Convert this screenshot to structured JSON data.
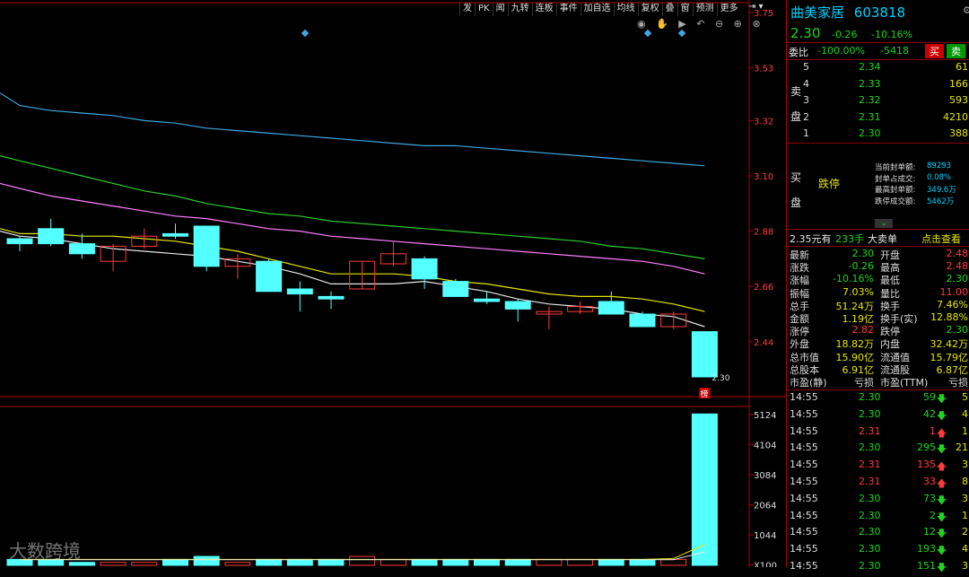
{
  "toolbar": [
    "发",
    "PK",
    "闻",
    "九转",
    "连板",
    "事件",
    "加自选",
    "均线",
    "复权",
    "叠",
    "窗",
    "预测",
    "更多"
  ],
  "stock": {
    "name": "曲美家居",
    "code": "603818",
    "price": "2.30",
    "change": "-0.26",
    "pct": "-10.16%"
  },
  "order_book": {
    "ratio_label": "委比",
    "ratio": "-100.00%",
    "diff": "-5418",
    "buy_btn": "买",
    "sell_btn": "卖",
    "sell_label": "卖盘",
    "buy_label": "买盘",
    "asks": [
      {
        "level": "5",
        "price": "2.34",
        "vol": "61"
      },
      {
        "level": "4",
        "price": "2.33",
        "vol": "166"
      },
      {
        "level": "3",
        "price": "2.32",
        "vol": "593"
      },
      {
        "level": "2",
        "price": "2.31",
        "vol": "4210"
      },
      {
        "level": "1",
        "price": "2.30",
        "vol": "388"
      }
    ],
    "limit_status": "跌停",
    "limit_info": [
      {
        "label": "当前封单额:",
        "value": "89293"
      },
      {
        "label": "封单占成交:",
        "value": "0.08%"
      },
      {
        "label": "最高封单额:",
        "value": "349.6万"
      },
      {
        "label": "跌停成交额:",
        "value": "5462万"
      }
    ]
  },
  "big_order": {
    "text1": "2.35元有",
    "text2": "233手",
    "text3": "大卖单",
    "link": "点击查看"
  },
  "stats": [
    [
      "最新",
      "2.30",
      "开盘",
      "2.48"
    ],
    [
      "涨跌",
      "-0.26",
      "最高",
      "2.48"
    ],
    [
      "涨幅",
      "-10.16%",
      "最低",
      "2.30"
    ],
    [
      "振幅",
      "7.03%",
      "量比",
      "11.00"
    ],
    [
      "总手",
      "51.24万",
      "换手",
      "7.46%"
    ],
    [
      "金额",
      "1.19亿",
      "换手(实)",
      "12.88%"
    ],
    [
      "涨停",
      "2.82",
      "跌停",
      "2.30"
    ],
    [
      "外盘",
      "18.82万",
      "内盘",
      "32.42万"
    ],
    [
      "总市值",
      "15.90亿",
      "流通值",
      "15.79亿"
    ],
    [
      "总股本",
      "6.91亿",
      "流通股",
      "6.87亿"
    ],
    [
      "市盈(静)",
      "亏损",
      "市盈(TTM)",
      "亏损"
    ]
  ],
  "ticks": [
    {
      "time": "14:55",
      "price": "2.30",
      "vol": "59",
      "dir": "down",
      "n": "5"
    },
    {
      "time": "14:55",
      "price": "2.30",
      "vol": "42",
      "dir": "down",
      "n": "4"
    },
    {
      "time": "14:55",
      "price": "2.31",
      "vol": "1",
      "dir": "up",
      "n": "1"
    },
    {
      "time": "14:55",
      "price": "2.30",
      "vol": "295",
      "dir": "down",
      "n": "21"
    },
    {
      "time": "14:55",
      "price": "2.31",
      "vol": "135",
      "dir": "up",
      "n": "3"
    },
    {
      "time": "14:55",
      "price": "2.31",
      "vol": "33",
      "dir": "up",
      "n": "8"
    },
    {
      "time": "14:55",
      "price": "2.30",
      "vol": "73",
      "dir": "down",
      "n": "3"
    },
    {
      "time": "14:55",
      "price": "2.30",
      "vol": "2",
      "dir": "down",
      "n": "1"
    },
    {
      "time": "14:55",
      "price": "2.30",
      "vol": "12",
      "dir": "down",
      "n": "2"
    },
    {
      "time": "14:55",
      "price": "2.30",
      "vol": "193",
      "dir": "down",
      "n": "4"
    },
    {
      "time": "14:55",
      "price": "2.30",
      "vol": "151",
      "dir": "down",
      "n": "3"
    }
  ],
  "price_axis": [
    "3.75",
    "3.53",
    "3.32",
    "3.10",
    "2.88",
    "2.66",
    "2.44"
  ],
  "vol_axis": [
    "5124",
    "4104",
    "3084",
    "2064",
    "1044",
    "X100"
  ],
  "last_price_label": "2.30",
  "badge": "榜",
  "watermark": "大数跨境",
  "colors": {
    "up": "#ff3b3b",
    "down": "#1fd31f",
    "candle_down": "#54ffff",
    "ma1": "#e8e8e8",
    "ma2": "#e6e600",
    "ma3": "#ff80ff",
    "ma4": "#2ecc2e",
    "ma5": "#3fa7e0"
  },
  "chart_data": {
    "type": "candlestick",
    "ylim": [
      2.3,
      3.8
    ],
    "candles": [
      {
        "o": 2.85,
        "c": 2.83,
        "h": 2.86,
        "l": 2.8
      },
      {
        "o": 2.89,
        "c": 2.83,
        "h": 2.93,
        "l": 2.82
      },
      {
        "o": 2.83,
        "c": 2.79,
        "h": 2.87,
        "l": 2.77
      },
      {
        "o": 2.76,
        "c": 2.82,
        "h": 2.83,
        "l": 2.72
      },
      {
        "o": 2.82,
        "c": 2.86,
        "h": 2.89,
        "l": 2.81
      },
      {
        "o": 2.87,
        "c": 2.86,
        "h": 2.91,
        "l": 2.85
      },
      {
        "o": 2.9,
        "c": 2.74,
        "h": 2.9,
        "l": 2.72
      },
      {
        "o": 2.74,
        "c": 2.77,
        "h": 2.79,
        "l": 2.69
      },
      {
        "o": 2.76,
        "c": 2.64,
        "h": 2.77,
        "l": 2.64
      },
      {
        "o": 2.65,
        "c": 2.63,
        "h": 2.68,
        "l": 2.56
      },
      {
        "o": 2.62,
        "c": 2.61,
        "h": 2.64,
        "l": 2.57
      },
      {
        "o": 2.65,
        "c": 2.76,
        "h": 2.76,
        "l": 2.65
      },
      {
        "o": 2.75,
        "c": 2.79,
        "h": 2.84,
        "l": 2.74
      },
      {
        "o": 2.77,
        "c": 2.69,
        "h": 2.78,
        "l": 2.65
      },
      {
        "o": 2.68,
        "c": 2.62,
        "h": 2.69,
        "l": 2.62
      },
      {
        "o": 2.61,
        "c": 2.6,
        "h": 2.64,
        "l": 2.59
      },
      {
        "o": 2.6,
        "c": 2.57,
        "h": 2.61,
        "l": 2.52
      },
      {
        "o": 2.55,
        "c": 2.56,
        "h": 2.58,
        "l": 2.49
      },
      {
        "o": 2.56,
        "c": 2.58,
        "h": 2.6,
        "l": 2.55
      },
      {
        "o": 2.6,
        "c": 2.55,
        "h": 2.64,
        "l": 2.55
      },
      {
        "o": 2.55,
        "c": 2.5,
        "h": 2.56,
        "l": 2.5
      },
      {
        "o": 2.5,
        "c": 2.55,
        "h": 2.56,
        "l": 2.49
      },
      {
        "o": 2.48,
        "c": 2.3,
        "h": 2.48,
        "l": 2.3
      }
    ],
    "volume": [
      2,
      2,
      1,
      1,
      1,
      2,
      3,
      1,
      2,
      2,
      2,
      3,
      2,
      2,
      2,
      2,
      2,
      2,
      2,
      2,
      2,
      2,
      51
    ],
    "volume_up": [
      false,
      false,
      false,
      true,
      true,
      false,
      false,
      true,
      false,
      false,
      false,
      true,
      true,
      false,
      false,
      false,
      false,
      true,
      true,
      false,
      false,
      true,
      false
    ],
    "ma_lines": [
      [
        2.86,
        2.85,
        2.83,
        2.81,
        2.8,
        2.79,
        2.78,
        2.76,
        2.74,
        2.71,
        2.67,
        2.67,
        2.67,
        2.68,
        2.66,
        2.64,
        2.61,
        2.59,
        2.58,
        2.57,
        2.55,
        2.54,
        2.5
      ],
      [
        2.87,
        2.87,
        2.86,
        2.86,
        2.85,
        2.84,
        2.82,
        2.8,
        2.77,
        2.74,
        2.71,
        2.71,
        2.71,
        2.7,
        2.68,
        2.67,
        2.65,
        2.63,
        2.62,
        2.62,
        2.61,
        2.59,
        2.56
      ],
      [
        3.05,
        3.02,
        3.0,
        2.98,
        2.96,
        2.94,
        2.93,
        2.91,
        2.89,
        2.88,
        2.86,
        2.85,
        2.84,
        2.83,
        2.82,
        2.81,
        2.8,
        2.79,
        2.78,
        2.77,
        2.76,
        2.74,
        2.71
      ],
      [
        3.16,
        3.13,
        3.1,
        3.07,
        3.04,
        3.02,
        2.99,
        2.97,
        2.95,
        2.94,
        2.92,
        2.91,
        2.9,
        2.89,
        2.88,
        2.87,
        2.86,
        2.85,
        2.84,
        2.82,
        2.81,
        2.79,
        2.77
      ],
      [
        3.38,
        3.36,
        3.35,
        3.34,
        3.32,
        3.31,
        3.29,
        3.28,
        3.27,
        3.26,
        3.25,
        3.24,
        3.23,
        3.22,
        3.22,
        3.21,
        3.2,
        3.19,
        3.18,
        3.17,
        3.16,
        3.15,
        3.14
      ]
    ]
  }
}
